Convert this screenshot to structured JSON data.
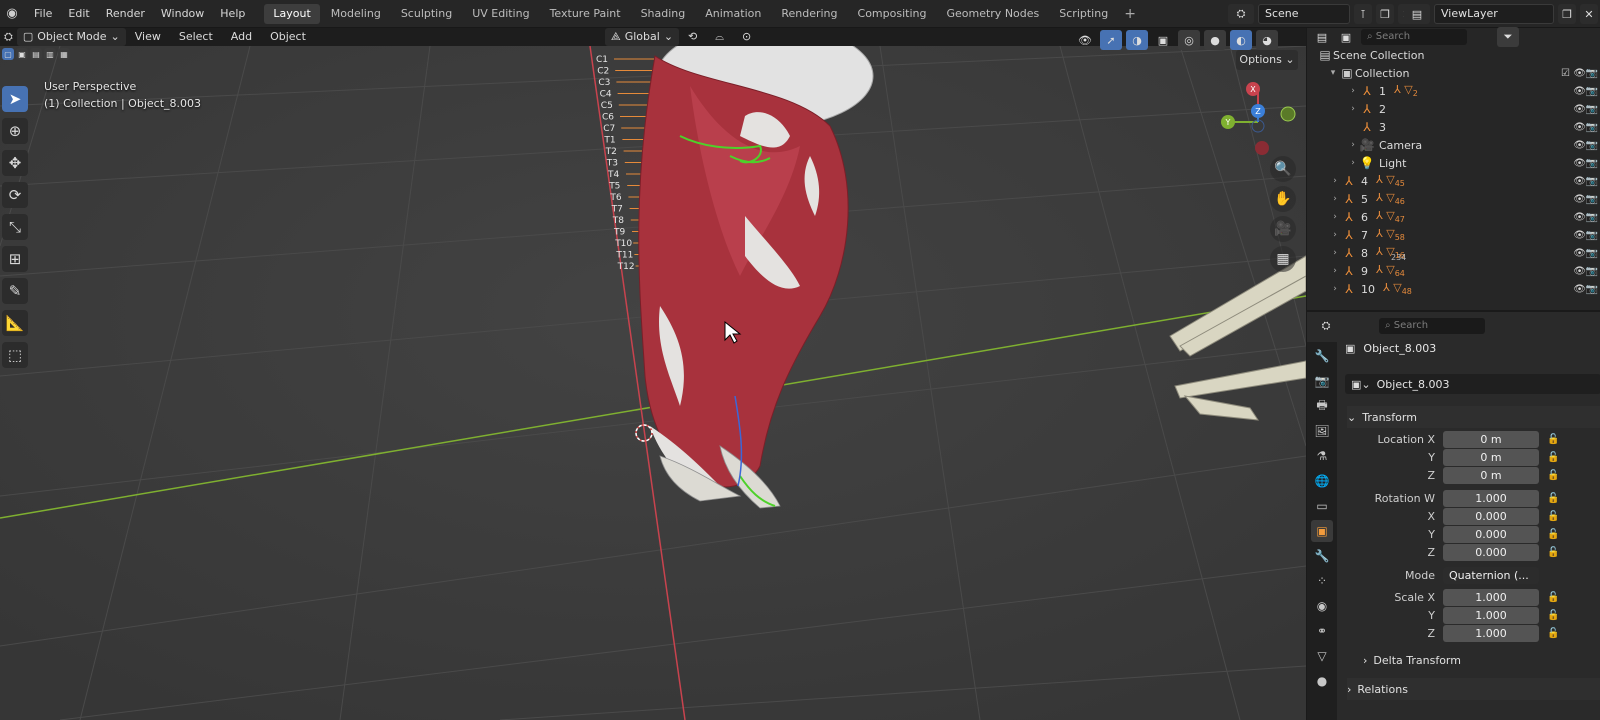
{
  "topbar": {
    "menus": [
      "File",
      "Edit",
      "Render",
      "Window",
      "Help"
    ],
    "workspace_tabs": [
      "Layout",
      "Modeling",
      "Sculpting",
      "UV Editing",
      "Texture Paint",
      "Shading",
      "Animation",
      "Rendering",
      "Compositing",
      "Geometry Nodes",
      "Scripting"
    ],
    "active_tab": "Layout",
    "scene": "Scene",
    "view_layer": "ViewLayer"
  },
  "viewport_header": {
    "mode": "Object Mode",
    "menus": [
      "View",
      "Select",
      "Add",
      "Object"
    ],
    "orientation": "Global"
  },
  "viewport": {
    "perspective_label": "User Perspective",
    "context_label": "(1) Collection | Object_8.003",
    "options_label": "Options",
    "gizmo": {
      "x": "X",
      "y": "Y",
      "z": "Z"
    },
    "spine_labels": [
      "C1",
      "C2",
      "C3",
      "C4",
      "C5",
      "C6",
      "C7",
      "T1",
      "T2",
      "T3",
      "T4",
      "T5",
      "T6",
      "T7",
      "T8",
      "T9",
      "T10",
      "T11",
      "T12"
    ],
    "colors": {
      "background": "#3e3e3e",
      "muscle": "#a8323d",
      "x_axis": "#c8434e",
      "y_axis": "#7fb030",
      "z_axis": "#3b7fd8"
    }
  },
  "outliner": {
    "search_placeholder": "Search",
    "scene_collection": "Scene Collection",
    "collection": "Collection",
    "rows": [
      {
        "name": "1",
        "icon": "armature-icon",
        "badge": "2"
      },
      {
        "name": "2",
        "icon": "armature-icon",
        "badge": ""
      },
      {
        "name": "3",
        "icon": "armature-icon",
        "badge": ""
      },
      {
        "name": "Camera",
        "icon": "camera-icon",
        "badge": ""
      },
      {
        "name": "Light",
        "icon": "light-icon",
        "badge": ""
      },
      {
        "name": "4",
        "icon": "armature-icon",
        "badge": "45"
      },
      {
        "name": "5",
        "icon": "armature-icon",
        "badge": "46"
      },
      {
        "name": "6",
        "icon": "armature-icon",
        "badge": "47"
      },
      {
        "name": "7",
        "icon": "armature-icon",
        "badge": "58"
      },
      {
        "name": "8",
        "icon": "armature-icon",
        "badge": "16"
      },
      {
        "name": "9",
        "icon": "armature-icon",
        "badge": "64"
      },
      {
        "name": "10",
        "icon": "armature-icon",
        "badge": "48"
      }
    ],
    "extra_badge_8": "234"
  },
  "properties": {
    "search_placeholder": "Search",
    "object_name": "Object_8.003",
    "data_name": "Object_8.003",
    "transform_label": "Transform",
    "location_x_label": "Location X",
    "y_label": "Y",
    "z_label": "Z",
    "x_label": "X",
    "location": {
      "x": "0 m",
      "y": "0 m",
      "z": "0 m"
    },
    "rotation_w_label": "Rotation W",
    "rotation": {
      "w": "1.000",
      "x": "0.000",
      "y": "0.000",
      "z": "0.000"
    },
    "mode_label": "Mode",
    "mode_value": "Quaternion (...",
    "scale_x_label": "Scale X",
    "scale": {
      "x": "1.000",
      "y": "1.000",
      "z": "1.000"
    },
    "delta_transform_label": "Delta Transform",
    "relations_label": "Relations"
  }
}
